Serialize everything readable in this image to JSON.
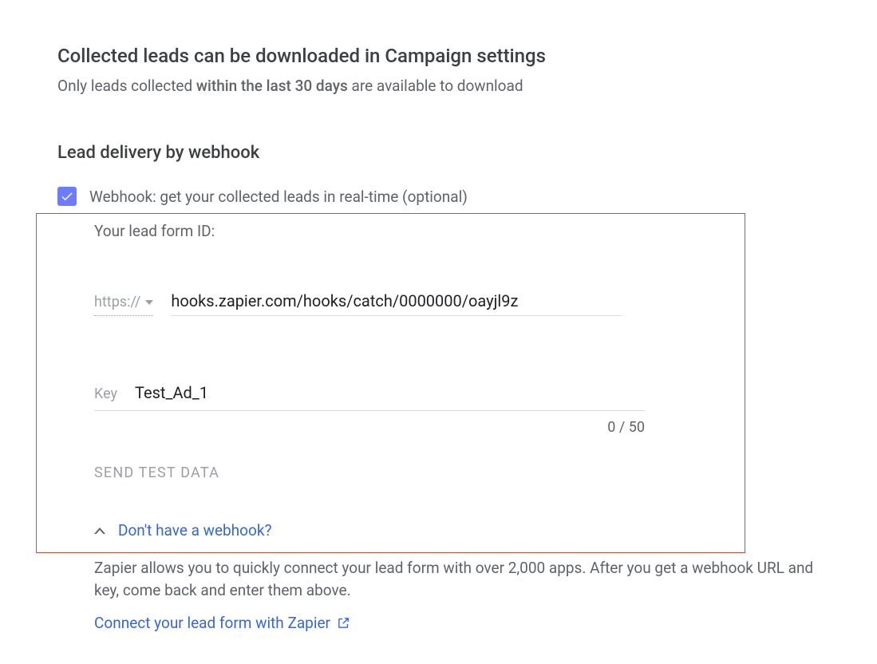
{
  "header": {
    "title": "Collected leads can be downloaded in Campaign settings",
    "subtext_prefix": "Only leads collected ",
    "subtext_bold": "within the last 30 days",
    "subtext_suffix": " are available to download"
  },
  "webhook": {
    "section_title": "Lead delivery by webhook",
    "checkbox_checked": true,
    "checkbox_label": "Webhook: get your collected leads in real-time (optional)",
    "form_id_label": "Your lead form ID:",
    "scheme": "https://",
    "url_value": "hooks.zapier.com/hooks/catch/0000000/oayjl9z",
    "key_label": "Key",
    "key_value": "Test_Ad_1",
    "key_counter": "0 / 50",
    "send_test_label": "SEND TEST DATA",
    "no_webhook_link": "Don't have a webhook?",
    "zapier_help": "Zapier allows you to quickly connect your lead form with over 2,000 apps. After you get a webhook URL and key, come back and enter them above.",
    "zapier_link": "Connect your lead form with Zapier"
  }
}
